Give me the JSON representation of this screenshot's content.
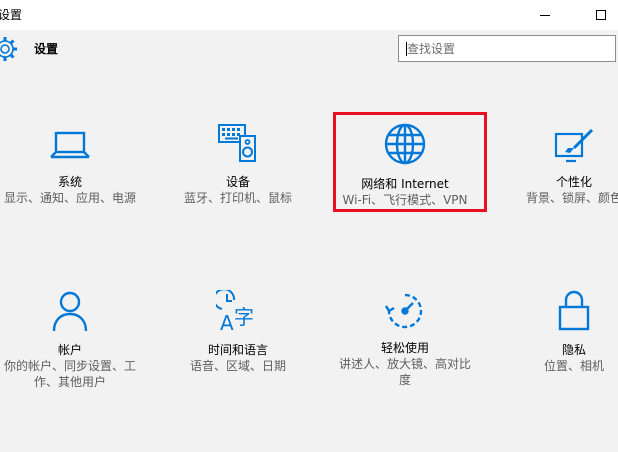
{
  "window": {
    "title": "设置"
  },
  "header": {
    "title": "设置"
  },
  "search": {
    "placeholder": "查找设置"
  },
  "tiles": [
    {
      "label": "系统",
      "desc": "显示、通知、应用、电源",
      "icon": "laptop-icon"
    },
    {
      "label": "设备",
      "desc": "蓝牙、打印机、鼠标",
      "icon": "devices-icon"
    },
    {
      "label": "网络和 Internet",
      "desc": "Wi-Fi、飞行模式、VPN",
      "icon": "globe-icon"
    },
    {
      "label": "个性化",
      "desc": "背景、锁屏、颜色",
      "icon": "personalization-icon"
    },
    {
      "label": "帐户",
      "desc": "你的帐户、同步设置、工作、其他用户",
      "icon": "person-icon"
    },
    {
      "label": "时间和语言",
      "desc": "语音、区域、日期",
      "icon": "time-language-icon"
    },
    {
      "label": "轻松使用",
      "desc": "讲述人、放大镜、高对比度",
      "icon": "ease-of-access-icon"
    },
    {
      "label": "隐私",
      "desc": "位置、相机",
      "icon": "lock-icon"
    }
  ],
  "colors": {
    "accent": "#0078d7",
    "highlight": "#e81123",
    "background": "#f2f2f2"
  }
}
